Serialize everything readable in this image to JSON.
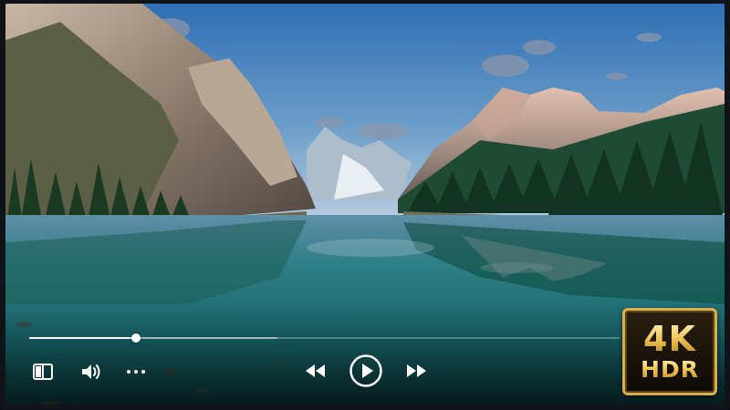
{
  "player": {
    "progress_fraction": 0.18,
    "buffered_fraction": 0.42,
    "badge": {
      "top": "4K",
      "bottom": "HDR"
    }
  },
  "controls": {
    "left": [
      {
        "name": "sidebar-toggle-icon"
      },
      {
        "name": "volume-icon"
      },
      {
        "name": "more-options-icon"
      }
    ],
    "center": [
      {
        "name": "rewind-icon"
      },
      {
        "name": "play-icon"
      },
      {
        "name": "fast-forward-icon"
      }
    ]
  },
  "colors": {
    "accent": "#ffffff",
    "badge_gold": "#d9ad4c",
    "water": "#1e6f73",
    "sky": "#3f78b8"
  }
}
